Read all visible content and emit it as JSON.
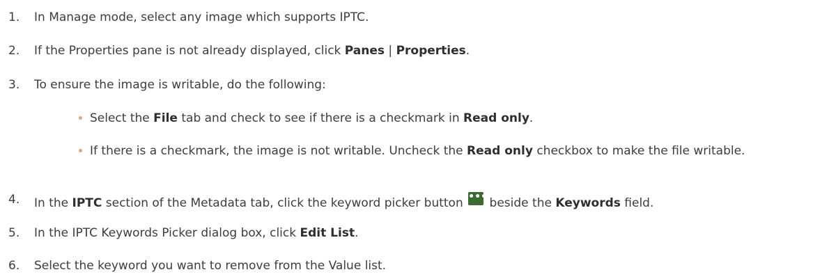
{
  "steps": [
    {
      "num": "1.",
      "text_a": "In Manage mode, select any image which supports IPTC."
    },
    {
      "num": "2.",
      "text_a": "If the Properties pane is not already displayed, click ",
      "bold_a": "Panes",
      "text_b": " | ",
      "bold_b": "Properties",
      "text_c": "."
    },
    {
      "num": "3.",
      "text_a": "To ensure the image is writable, do the following:",
      "bullets": [
        {
          "text_a": "Select the ",
          "bold_a": "File",
          "text_b": " tab and check to see if there is a checkmark in ",
          "bold_b": "Read only",
          "text_c": "."
        },
        {
          "text_a": "If there is a checkmark, the image is not writable. Uncheck the ",
          "bold_a": "Read only",
          "text_b": " checkbox to make the file writable."
        }
      ]
    },
    {
      "num": "4.",
      "text_a": "In the ",
      "bold_a": "IPTC",
      "text_b": " section of the Metadata tab, click the keyword picker button ",
      "button_glyph": "•••",
      "text_c": " beside the ",
      "bold_b": "Keywords",
      "text_d": " field."
    },
    {
      "num": "5.",
      "text_a": "In the IPTC Keywords Picker dialog box, click ",
      "bold_a": "Edit List",
      "text_b": "."
    },
    {
      "num": "6.",
      "text_a": "Select the keyword you want to remove from the Value list."
    }
  ],
  "colors": {
    "text": "#3d3d3d",
    "bullet": "#e4a08a",
    "picker_button": "#3b6a33"
  },
  "icons": {
    "picker_button": "ellipsis-icon",
    "bullet": "bullet-dot-icon"
  }
}
